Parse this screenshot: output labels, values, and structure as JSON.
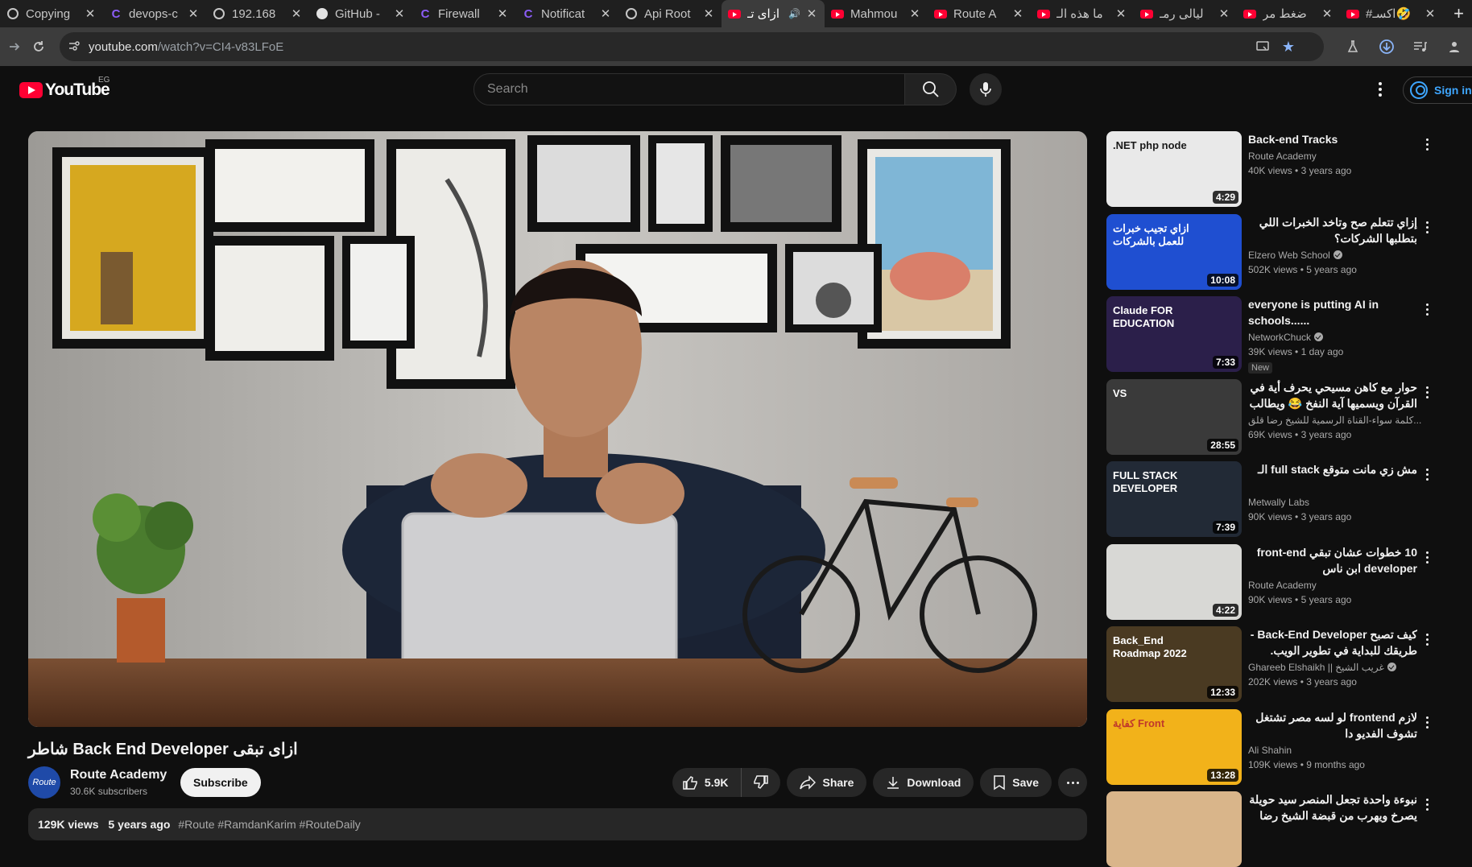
{
  "browser": {
    "tabs": [
      {
        "icon": "copy-icon",
        "title": "Copying",
        "active": false
      },
      {
        "icon": "c-logo-icon",
        "title": "devops-c",
        "active": false
      },
      {
        "icon": "globe-icon",
        "title": "192.168",
        "active": false
      },
      {
        "icon": "github-icon",
        "title": "GitHub -",
        "active": false
      },
      {
        "icon": "c-logo-icon",
        "title": "Firewall",
        "active": false
      },
      {
        "icon": "c-logo-icon",
        "title": "Notificat",
        "active": false
      },
      {
        "icon": "globe-icon",
        "title": "Api Root",
        "active": false
      },
      {
        "icon": "youtube-icon",
        "title": "ازاى تـ",
        "active": true
      },
      {
        "icon": "youtube-icon",
        "title": "Mahmou",
        "active": false
      },
      {
        "icon": "youtube-icon",
        "title": "Route A",
        "active": false
      },
      {
        "icon": "youtube-icon",
        "title": "ما هذه الـ",
        "active": false
      },
      {
        "icon": "youtube-icon",
        "title": "ليالى رمـ",
        "active": false
      },
      {
        "icon": "youtube-icon",
        "title": "ضغط مر",
        "active": false
      },
      {
        "icon": "youtube-icon",
        "title": "#اكسـ🤣",
        "active": false
      }
    ],
    "url_host": "youtube.com",
    "url_path": "/watch?v=CI4-v83LFoE"
  },
  "youtube": {
    "logo_text": "YouTube",
    "country": "EG",
    "search_placeholder": "Search",
    "signin_label": "Sign in"
  },
  "video": {
    "title": "ازاى تبقى Back End Developer شاطر",
    "channel_name": "Route Academy",
    "channel_avatar_text": "Route",
    "subscribers": "30.6K subscribers",
    "subscribe_label": "Subscribe",
    "likes": "5.9K",
    "share_label": "Share",
    "download_label": "Download",
    "save_label": "Save",
    "views": "129K views",
    "uploaded": "5 years ago",
    "hashtags": "#Route #RamdanKarim #RouteDaily"
  },
  "recommendations": [
    {
      "title": "Back-end Tracks",
      "rtl": false,
      "channel": "Route Academy",
      "verified": false,
      "views": "40K views",
      "age": "3 years ago",
      "duration": "4:29",
      "badge": "",
      "thumb_text": ".NET php node"
    },
    {
      "title": "إزاي تتعلم صح وتاخد الخبرات اللي بتطلبها الشركات؟",
      "rtl": true,
      "channel": "Elzero Web School",
      "verified": true,
      "views": "502K views",
      "age": "5 years ago",
      "duration": "10:08",
      "badge": "",
      "thumb_text": "ازاي تجيب خبرات للعمل بالشركات"
    },
    {
      "title": "everyone is putting AI in schools......",
      "rtl": false,
      "channel": "NetworkChuck",
      "verified": true,
      "views": "39K views",
      "age": "1 day ago",
      "duration": "7:33",
      "badge": "New",
      "thumb_text": "Claude FOR EDUCATION"
    },
    {
      "title": "حوار مع كاهن مسيحي يحرف أية في القرآن ويسميها آية النفخ 😂 ويطالب",
      "rtl": true,
      "channel": "كلمة سواء-القناة الرسمية للشيخ رضا قلق...",
      "verified": false,
      "views": "69K views",
      "age": "3 years ago",
      "duration": "28:55",
      "badge": "",
      "thumb_text": "VS"
    },
    {
      "title": "مش زي مانت متوقع full stack الـ",
      "rtl": true,
      "channel": "Metwally Labs",
      "verified": false,
      "views": "90K views",
      "age": "3 years ago",
      "duration": "7:39",
      "badge": "",
      "thumb_text": "FULL STACK DEVELOPER"
    },
    {
      "title": "10 خطوات عشان تبقي front-end developer ابن ناس",
      "rtl": true,
      "channel": "Route Academy",
      "verified": false,
      "views": "90K views",
      "age": "5 years ago",
      "duration": "4:22",
      "badge": "",
      "thumb_text": ""
    },
    {
      "title": "كيف تصبح Back-End Developer - طريقك للبداية في تطوير الويب.",
      "rtl": true,
      "channel": "Ghareeb Elshaikh || غريب الشيخ",
      "verified": true,
      "views": "202K views",
      "age": "3 years ago",
      "duration": "12:33",
      "badge": "",
      "thumb_text": "Back_End Roadmap 2022"
    },
    {
      "title": "لازم frontend لو لسه مصر تشتغل تشوف الفديو دا",
      "rtl": true,
      "channel": "Ali Shahin",
      "verified": false,
      "views": "109K views",
      "age": "9 months ago",
      "duration": "13:28",
      "badge": "",
      "thumb_text": "كفاية Front"
    },
    {
      "title": "نبوءة واحدة تجعل المنصر سيد حويلة يصرخ ويهرب من قبضة الشيخ رضا",
      "rtl": true,
      "channel": "",
      "verified": false,
      "views": "",
      "age": "",
      "duration": "",
      "badge": "",
      "thumb_text": ""
    }
  ]
}
